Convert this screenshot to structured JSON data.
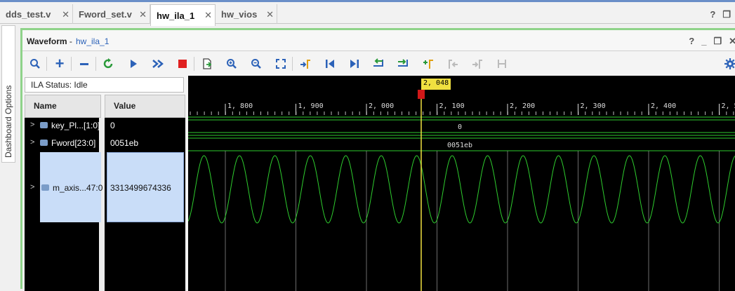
{
  "tabs": [
    {
      "label": "dds_test.v",
      "closable": true
    },
    {
      "label": "Fword_set.v",
      "closable": true
    },
    {
      "label": "hw_ila_1",
      "closable": true,
      "active": true
    },
    {
      "label": "hw_vios",
      "closable": true
    }
  ],
  "dashboard_label": "Dashboard Options",
  "window": {
    "title": "Waveform",
    "separator": "-",
    "subtitle": "hw_ila_1"
  },
  "toolbar_icons": [
    "search-icon",
    "add-icon",
    "remove-icon",
    "refresh-icon",
    "run-icon",
    "run-all-icon",
    "stop-icon",
    "export-icon",
    "zoom-in-icon",
    "zoom-out-icon",
    "zoom-fit-icon",
    "marker-icon",
    "go-first-icon",
    "go-last-icon",
    "prev-transition-icon",
    "next-transition-icon",
    "add-marker-icon",
    "prev-marker-icon",
    "next-marker-icon",
    "swap-cursor-icon",
    "settings-icon"
  ],
  "ila_status": "ILA Status:  Idle",
  "columns": {
    "name": "Name",
    "value": "Value"
  },
  "signals": [
    {
      "name": "key_Pl...[1:0]",
      "value": "0"
    },
    {
      "name": "Fword[23:0]",
      "value": "0051eb"
    },
    {
      "name": "m_axis...47:0",
      "value": "3313499674336"
    }
  ],
  "timeline": {
    "ticks": [
      "1, 800",
      "1, 900",
      "2, 000",
      "2, 100",
      "2, 200",
      "2, 300",
      "2, 400",
      "2, 50"
    ],
    "cursor": "2, 048"
  },
  "bus_values": {
    "key": "0",
    "fword": "0051eb"
  },
  "colors": {
    "accent_green": "#8fd38a",
    "wave_green": "#2ecc2e",
    "cursor_yellow": "#f0e040",
    "selection": "#c9ddf8"
  }
}
